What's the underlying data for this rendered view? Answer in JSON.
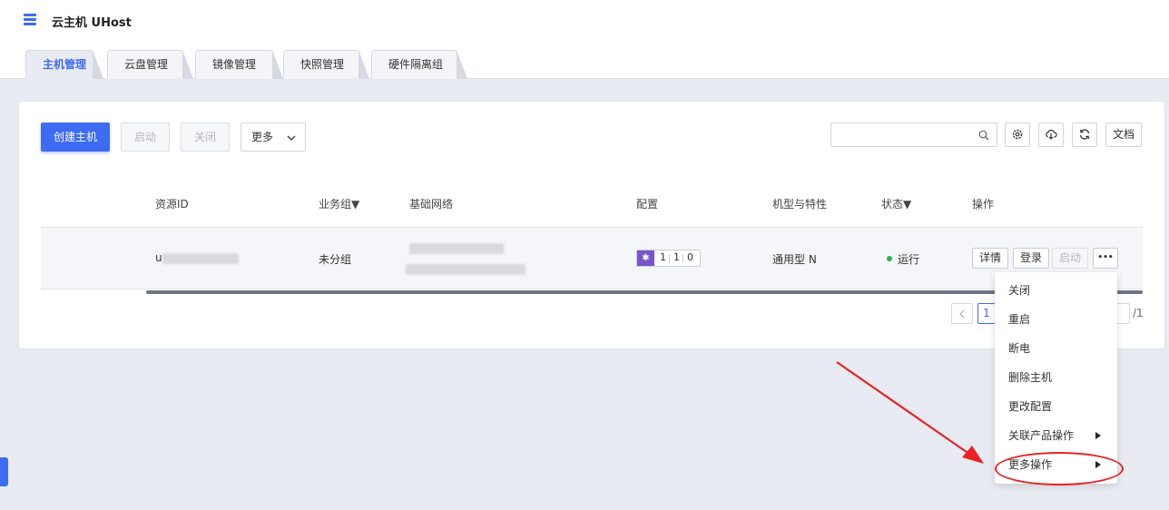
{
  "app": {
    "title": "云主机 UHost"
  },
  "tabs": [
    {
      "label": "主机管理",
      "active": true
    },
    {
      "label": "云盘管理",
      "active": false
    },
    {
      "label": "镜像管理",
      "active": false
    },
    {
      "label": "快照管理",
      "active": false
    },
    {
      "label": "硬件隔离组",
      "active": false
    }
  ],
  "toolbar": {
    "create_label": "创建主机",
    "start_label": "启动",
    "stop_label": "关闭",
    "more_label": "更多",
    "docs_label": "文档",
    "search_placeholder": ""
  },
  "table": {
    "headers": {
      "resource_id": "资源ID",
      "group": "业务组▼",
      "network": "基础网络",
      "config": "配置",
      "type": "机型与特性",
      "status": "状态▼",
      "actions": "操作"
    },
    "row": {
      "resource_id_prefix": "u",
      "group": "未分组",
      "config": {
        "cpu": "1",
        "mem": "1",
        "disk": "0"
      },
      "type": "通用型 N",
      "status": "运行",
      "actions": {
        "detail": "详情",
        "login": "登录",
        "start": "启动",
        "more": "•••"
      }
    }
  },
  "pagination": {
    "current": "1",
    "total": "/1"
  },
  "dropdown_menu": {
    "items": [
      {
        "label": "关闭",
        "submenu": false
      },
      {
        "label": "重启",
        "submenu": false
      },
      {
        "label": "断电",
        "submenu": false
      },
      {
        "label": "删除主机",
        "submenu": false
      },
      {
        "label": "更改配置",
        "submenu": false
      },
      {
        "label": "关联产品操作",
        "submenu": true
      },
      {
        "label": "更多操作",
        "submenu": true
      }
    ]
  },
  "colors": {
    "primary": "#3d6bf2",
    "status_running": "#28b349",
    "annotation": "#e82222",
    "config_icon": "#7a55c9"
  }
}
